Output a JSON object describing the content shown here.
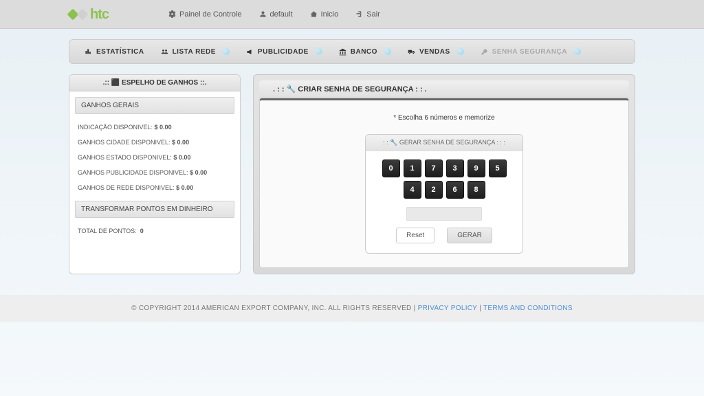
{
  "header": {
    "logo_text": "htc",
    "menu": {
      "painel": "Painel de Controle",
      "user": "default",
      "inicio": "Inicio",
      "sair": "Sair"
    }
  },
  "nav": {
    "estatistica": "ESTATÍSTICA",
    "lista_rede": "LISTA REDE",
    "publicidade": "PUBLICIDADE",
    "banco": "BANCO",
    "vendas": "VENDAS",
    "senha": "SENHA SEGURANÇA"
  },
  "left_panel": {
    "title": ".:: ⬛ ESPELHO DE GANHOS ::.",
    "ganhos_gerais": "GANHOS GERAIS",
    "rows": [
      {
        "label": "INDICAÇÃO DISPONIVEL:",
        "value": "$ 0.00"
      },
      {
        "label": "GANHOS CIDADE DISPONIVEL:",
        "value": "$ 0.00"
      },
      {
        "label": "GANHOS ESTADO DISPONIVEL:",
        "value": "$ 0.00"
      },
      {
        "label": "GANHOS PUBLICIDADE DISPONIVEL:",
        "value": "$ 0.00"
      },
      {
        "label": "GANHOS DE REDE DISPONIVEL:",
        "value": "$ 0.00"
      }
    ],
    "transformar": "TRANSFORMAR PONTOS EM DINHEIRO",
    "total_label": "TOTAL DE PONTOS:",
    "total_value": "0"
  },
  "right_panel": {
    "title": ". : : 🔧 CRIAR SENHA DE SEGURANÇA : : .",
    "instruction": "* Escolha 6 números e memorize",
    "keypad_title": ": : 🔧 GERAR SENHA DE SEGURANÇA : : :",
    "keys": [
      "0",
      "1",
      "7",
      "3",
      "9",
      "5",
      "4",
      "2",
      "6",
      "8"
    ],
    "reset": "Reset",
    "gerar": "GERAR"
  },
  "footer": {
    "copyright": "© COPYRIGHT 2014 AMERICAN EXPORT COMPANY, INC. ALL RIGHTS RESERVED",
    "sep": "  |  ",
    "privacy": "PRIVACY POLICY",
    "terms": "TERMS AND CONDITIONS"
  }
}
